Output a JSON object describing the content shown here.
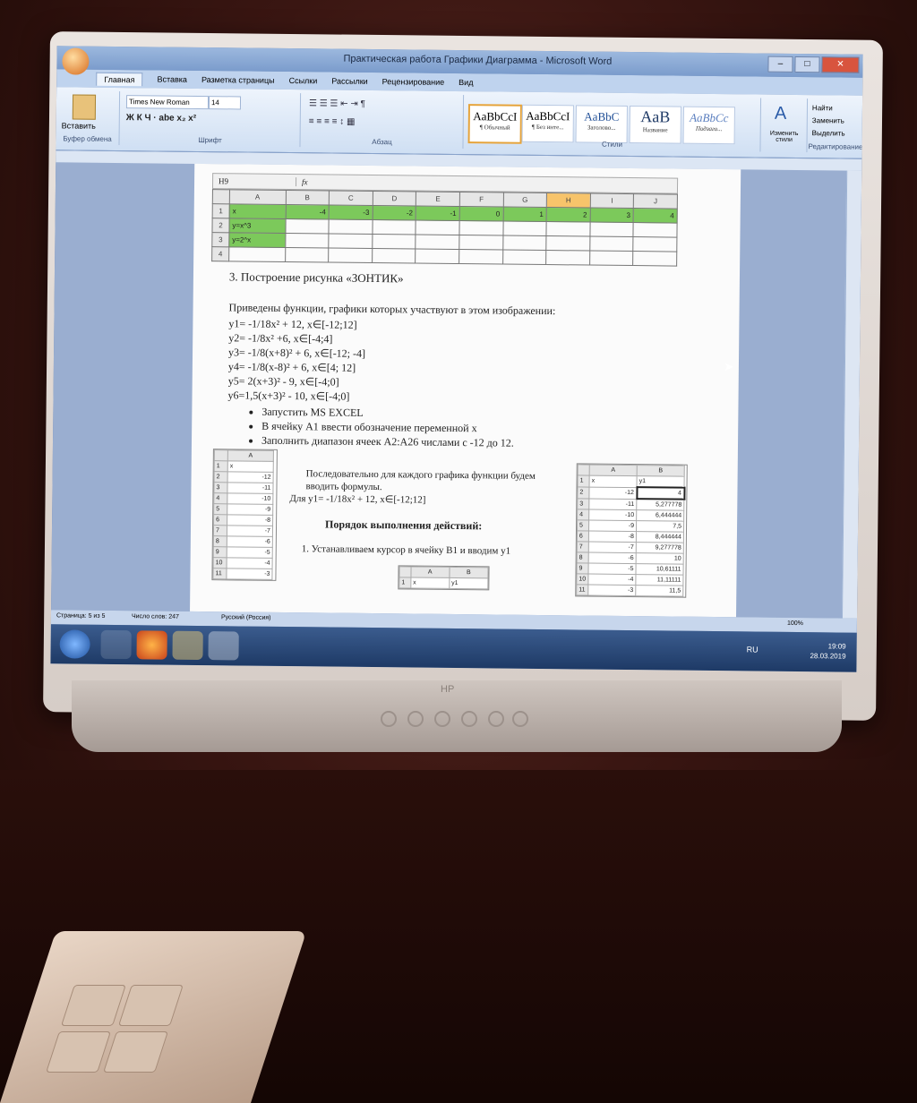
{
  "window": {
    "title": "Практическая работа Графики Диаграмма - Microsoft Word"
  },
  "ribbon": {
    "tabs": [
      "Главная",
      "Вставка",
      "Разметка страницы",
      "Ссылки",
      "Рассылки",
      "Рецензирование",
      "Вид"
    ],
    "font_name": "Times New Roman",
    "font_size": "14",
    "groups": [
      "Буфер обмена",
      "Шрифт",
      "Абзац",
      "Стили",
      "Редактирование"
    ],
    "paste_label": "Вставить",
    "styles": [
      {
        "sample": "AaBbCcI",
        "name": "¶ Обычный"
      },
      {
        "sample": "AaBbCcI",
        "name": "¶ Без инте..."
      },
      {
        "sample": "AaBbC",
        "name": "Заголово..."
      },
      {
        "sample": "AaB",
        "name": "Название"
      },
      {
        "sample": "AaBbCc",
        "name": "Подзаго..."
      }
    ],
    "change_styles": "Изменить стили",
    "edit_items": [
      "Найти",
      "Заменить",
      "Выделить"
    ]
  },
  "excel": {
    "cell_ref": "H9",
    "fx": "fx",
    "columns": [
      "A",
      "B",
      "C",
      "D",
      "E",
      "F",
      "G",
      "H",
      "I",
      "J"
    ],
    "rows": [
      {
        "n": "1",
        "a": "x",
        "vals": [
          "-4",
          "-3",
          "-2",
          "-1",
          "0",
          "1",
          "2",
          "3",
          "4"
        ]
      },
      {
        "n": "2",
        "a": "y=x^3",
        "vals": [
          "",
          "",
          "",
          "",
          "",
          "",
          "",
          "",
          ""
        ]
      },
      {
        "n": "3",
        "a": "y=2^x",
        "vals": [
          "",
          "",
          "",
          "",
          "",
          "",
          "",
          "",
          ""
        ]
      },
      {
        "n": "4",
        "a": "",
        "vals": [
          "",
          "",
          "",
          "",
          "",
          "",
          "",
          "",
          ""
        ]
      }
    ]
  },
  "doc": {
    "heading": "3. Построение рисунка «ЗОНТИК»",
    "intro": "Приведены функции, графики которых участвуют в этом изображении:",
    "functions": [
      "y1= -1/18x² + 12, x∈[-12;12]",
      "y2= -1/8x² +6, x∈[-4;4]",
      "y3= -1/8(x+8)² + 6, x∈[-12; -4]",
      "y4= -1/8(x-8)² + 6, x∈[4; 12]",
      "y5= 2(x+3)² - 9, x∈[-4;0]",
      "y6=1,5(x+3)² - 10, x∈[-4;0]"
    ],
    "bullets": [
      "Запустить MS EXCEL",
      "В ячейку A1 ввести обозначение переменной x",
      "Заполнить диапазон ячеек A2:A26 числами с -12 до 12."
    ],
    "bullet2": "Последовательно для каждого графика функции будем вводить формулы.",
    "for_y1": "Для y1= -1/18x² + 12, x∈[-12;12]",
    "order": "Порядок выполнения действий:",
    "step1": "1.  Устанавливаем курсор в ячейку B1 и вводим y1"
  },
  "left_mini": {
    "header": "A",
    "first": "x",
    "values": [
      "-12",
      "-11",
      "-10",
      "-9",
      "-8",
      "-7",
      "-6",
      "-5",
      "-4",
      "-3"
    ]
  },
  "right_mini": {
    "cols": [
      "A",
      "B"
    ],
    "head": [
      "x",
      "y1"
    ],
    "rows": [
      [
        "-12",
        "4"
      ],
      [
        "-11",
        "5,277778"
      ],
      [
        "-10",
        "6,444444"
      ],
      [
        "-9",
        "7,5"
      ],
      [
        "-8",
        "8,444444"
      ],
      [
        "-7",
        "9,277778"
      ],
      [
        "-6",
        "10"
      ],
      [
        "-5",
        "10,61111"
      ],
      [
        "-4",
        "11,11111"
      ],
      [
        "-3",
        "11,5"
      ]
    ]
  },
  "small_mini": {
    "cols": [
      "A",
      "B"
    ],
    "row": [
      "x",
      "y1"
    ]
  },
  "status": {
    "page": "Страница: 5 из 5",
    "words": "Число слов: 247",
    "lang": "Русский (Россия)",
    "zoom": "100%"
  },
  "tray": {
    "lang": "RU",
    "time": "19:09",
    "date": "28.03.2019"
  },
  "monitor": {
    "brand": "HP"
  }
}
